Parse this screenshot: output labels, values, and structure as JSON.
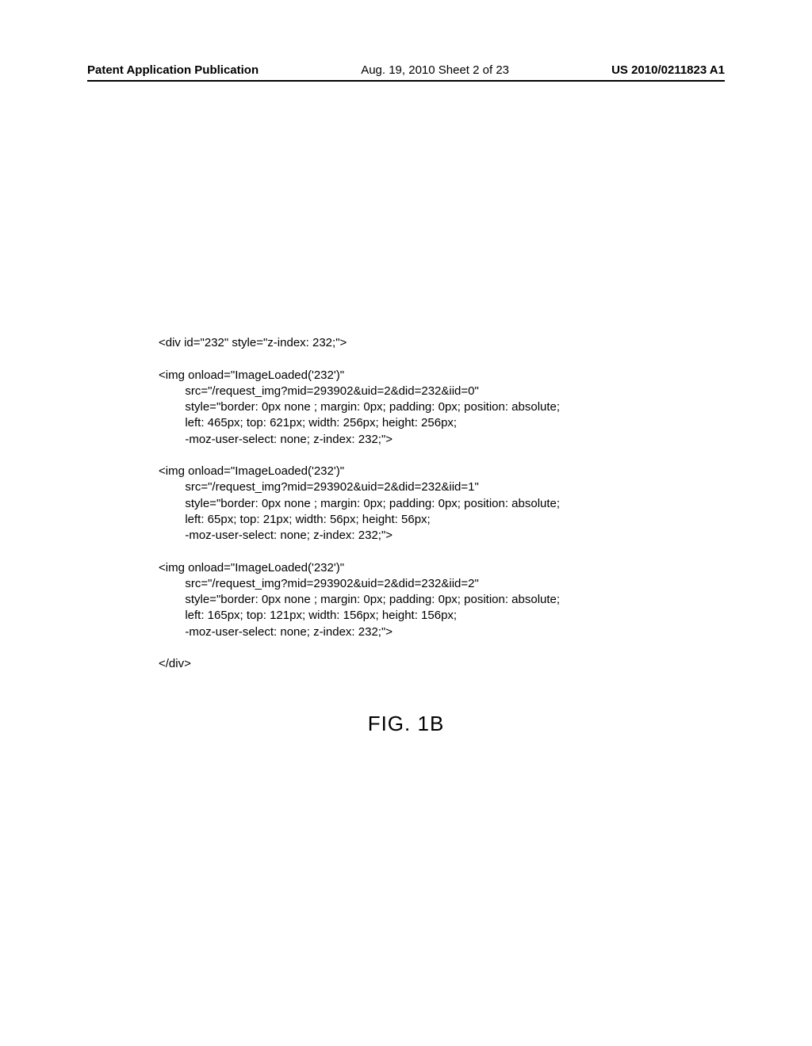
{
  "header": {
    "left": "Patent Application Publication",
    "center": "Aug. 19, 2010  Sheet 2 of 23",
    "right": "US 2010/0211823 A1"
  },
  "code": {
    "line1": "<div id=\"232\" style=\"z-index: 232;\">",
    "block1": {
      "l1": "<img onload=\"ImageLoaded('232')\"",
      "l2": "        src=\"/request_img?mid=293902&uid=2&did=232&iid=0\"",
      "l3": "        style=\"border: 0px none ; margin: 0px; padding: 0px; position: absolute;",
      "l4": "        left: 465px; top: 621px; width: 256px; height: 256px;",
      "l5": "        -moz-user-select: none; z-index: 232;\">"
    },
    "block2": {
      "l1": "<img onload=\"ImageLoaded('232')\"",
      "l2": "        src=\"/request_img?mid=293902&uid=2&did=232&iid=1\"",
      "l3": "        style=\"border: 0px none ; margin: 0px; padding: 0px; position: absolute;",
      "l4": "        left: 65px; top: 21px; width: 56px; height: 56px;",
      "l5": "        -moz-user-select: none; z-index: 232;\">"
    },
    "block3": {
      "l1": "<img onload=\"ImageLoaded('232')\"",
      "l2": "        src=\"/request_img?mid=293902&uid=2&did=232&iid=2\"",
      "l3": "        style=\"border: 0px none ; margin: 0px; padding: 0px; position: absolute;",
      "l4": "        left: 165px; top: 121px; width: 156px; height: 156px;",
      "l5": "        -moz-user-select: none; z-index: 232;\">"
    },
    "close": "</div>"
  },
  "figure": {
    "label": "FIG. 1B"
  }
}
